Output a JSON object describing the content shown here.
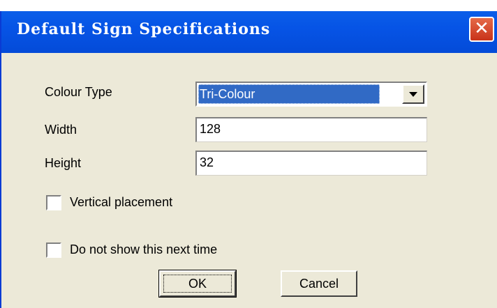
{
  "window": {
    "title": "Default Sign Specifications",
    "close_glyph": "✕"
  },
  "form": {
    "colour_type_label": "Colour Type",
    "colour_type_value": "Tri-Colour",
    "width_label": "Width",
    "width_value": "128",
    "height_label": "Height",
    "height_value": "32",
    "vertical_placement_label": "Vertical placement",
    "vertical_placement_checked": false,
    "do_not_show_label": "Do not show this next time",
    "do_not_show_checked": false
  },
  "buttons": {
    "ok_label": "OK",
    "cancel_label": "Cancel"
  },
  "icons": {
    "close": "close-icon",
    "dropdown": "chevron-down-icon"
  },
  "colors": {
    "titlebar": "#0654e6",
    "selection": "#316ac5",
    "close": "#c8321a",
    "dialog_bg": "#ece9d8"
  }
}
